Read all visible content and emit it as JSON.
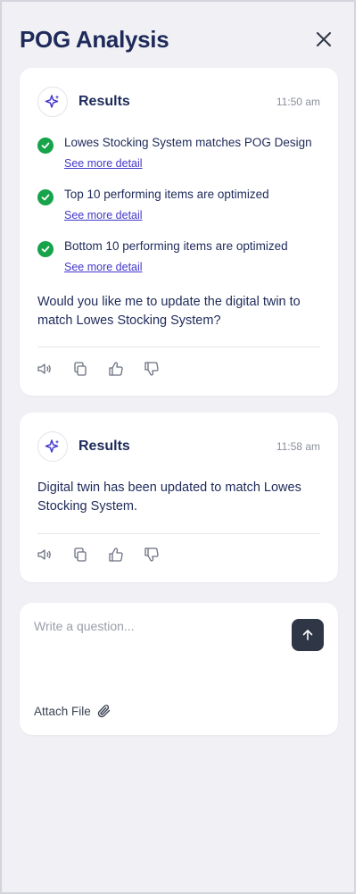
{
  "header": {
    "title": "POG Analysis"
  },
  "cards": [
    {
      "title": "Results",
      "time": "11:50 am",
      "checks": [
        {
          "text": "Lowes Stocking System matches POG Design",
          "link": "See more detail"
        },
        {
          "text": "Top 10 performing items are optimized",
          "link": "See more detail"
        },
        {
          "text": "Bottom 10 performing items are optimized",
          "link": "See more detail"
        }
      ],
      "message": "Would you like me to update the digital twin to match Lowes Stocking System?"
    },
    {
      "title": "Results",
      "time": "11:58 am",
      "message": "Digital twin has been updated to match Lowes Stocking System."
    }
  ],
  "composer": {
    "placeholder": "Write a question...",
    "attach_label": "Attach File"
  },
  "colors": {
    "accent": "#4338ca",
    "success": "#16a34a",
    "title": "#1e2a5a",
    "send_button": "#2f3645"
  },
  "icons": {
    "close": "close-icon",
    "sparkle": "sparkle-icon",
    "check": "check-circle-icon",
    "speaker": "speaker-icon",
    "copy": "copy-icon",
    "thumbs_up": "thumbs-up-icon",
    "thumbs_down": "thumbs-down-icon",
    "send": "arrow-up-icon",
    "attach": "paperclip-icon"
  }
}
